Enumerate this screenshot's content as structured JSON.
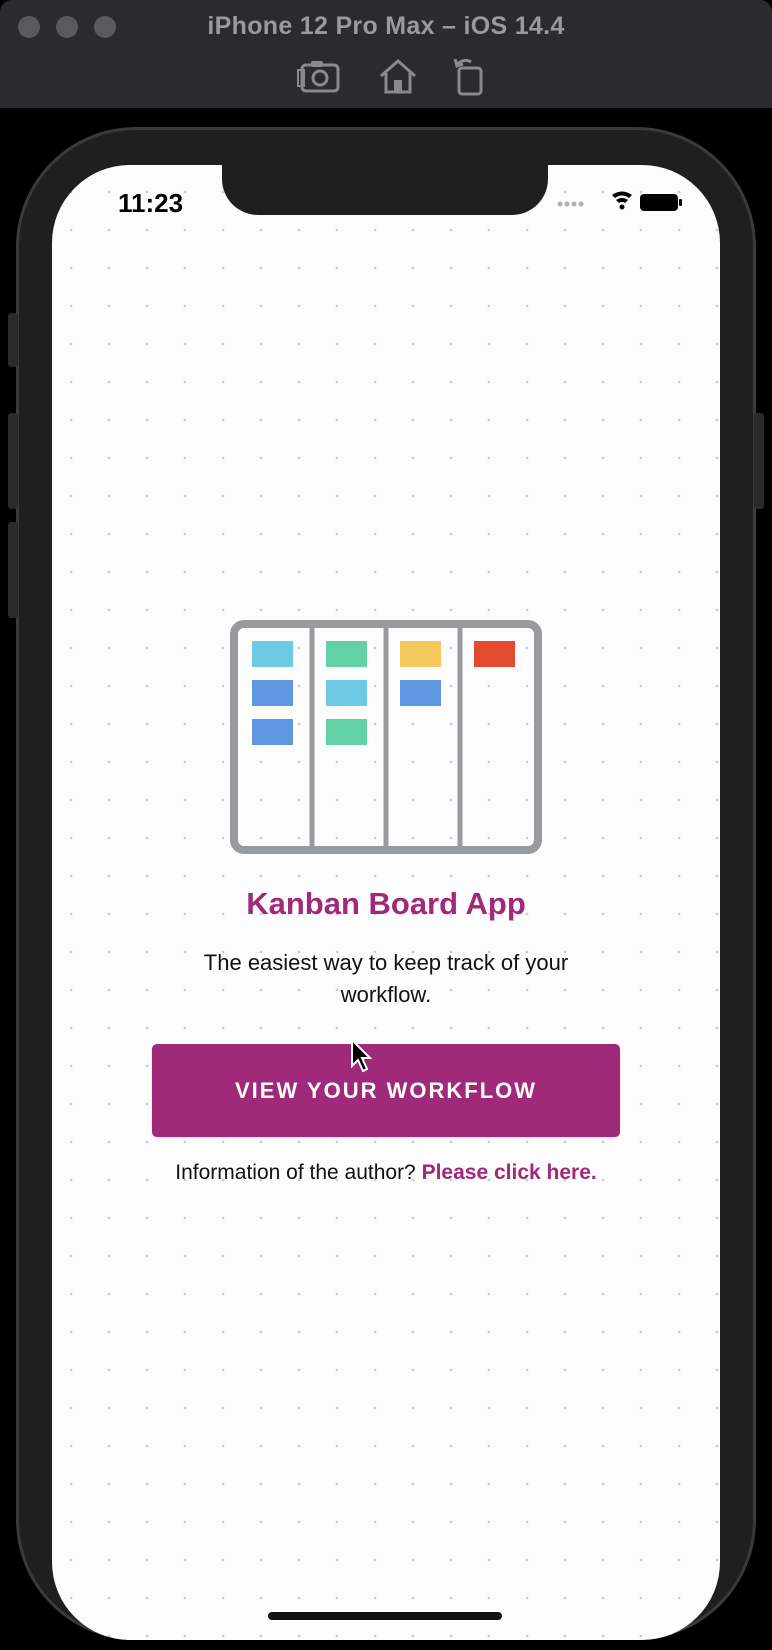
{
  "window": {
    "title": "iPhone 12 Pro Max – iOS 14.4",
    "tools": [
      {
        "icon": "screenshot-icon"
      },
      {
        "icon": "home-icon"
      },
      {
        "icon": "rotate-icon"
      }
    ]
  },
  "status_bar": {
    "time": "11:23",
    "icons": [
      "signal-dots-icon",
      "wifi-icon",
      "battery-icon"
    ]
  },
  "board_illustration": {
    "frame_color": "#979b9e",
    "columns": [
      {
        "cards": [
          "#6ec9e4",
          "#5f97e0",
          "#5f97e0"
        ]
      },
      {
        "cards": [
          "#63d1a6",
          "#6ec9e4",
          "#63d1a6"
        ]
      },
      {
        "cards": [
          "#f5c85e",
          "#5f97e0"
        ]
      },
      {
        "cards": [
          "#e44a2e"
        ]
      }
    ]
  },
  "main": {
    "title": "Kanban Board App",
    "tagline": "The easiest way to keep track of your workflow.",
    "cta_label": "VIEW YOUR WORKFLOW",
    "author_prompt": "Information of the author?",
    "author_link": "Please click here."
  },
  "colors": {
    "brand": "#a0297a"
  }
}
